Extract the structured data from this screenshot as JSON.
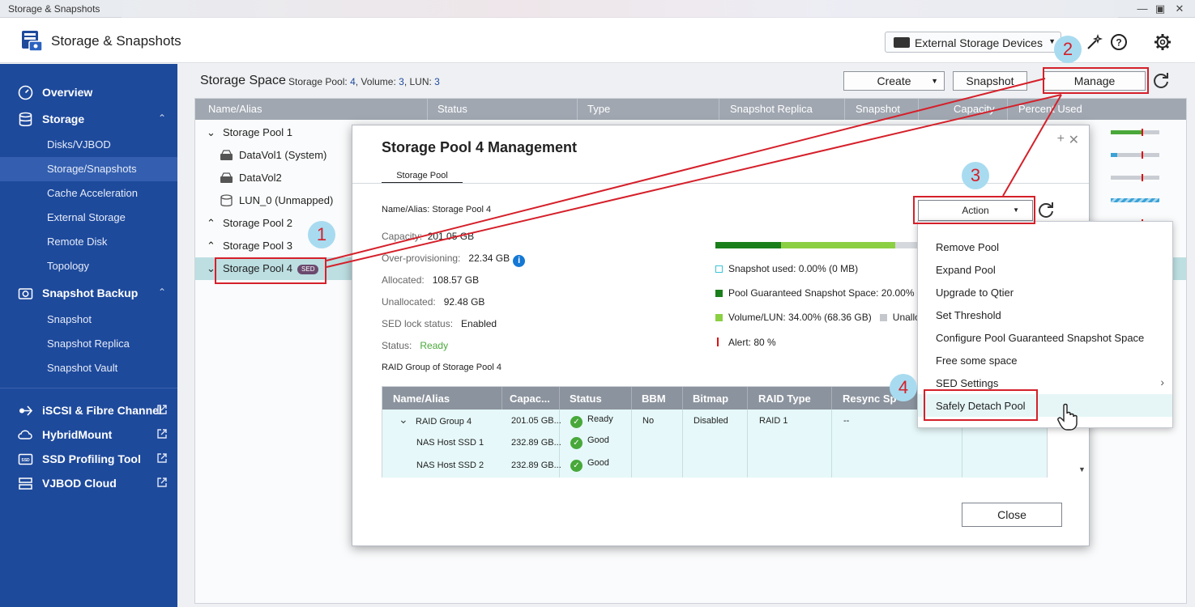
{
  "window": {
    "title": "Storage & Snapshots"
  },
  "header": {
    "app_title": "Storage & Snapshots",
    "external_devices": "External Storage Devices"
  },
  "sidebar": {
    "overview": "Overview",
    "storage": "Storage",
    "storage_items": [
      "Disks/VJBOD",
      "Storage/Snapshots",
      "Cache Acceleration",
      "External Storage",
      "Remote Disk",
      "Topology"
    ],
    "snapshot_backup": "Snapshot Backup",
    "snapshot_items": [
      "Snapshot",
      "Snapshot Replica",
      "Snapshot Vault"
    ],
    "external_links": [
      "iSCSI & Fibre Channel",
      "HybridMount",
      "SSD Profiling Tool",
      "VJBOD Cloud"
    ]
  },
  "main": {
    "title": "Storage Space",
    "subtitle": {
      "pool_label": "Storage Pool:",
      "pool_count": "4",
      "volume_label": "Volume:",
      "volume_count": "3",
      "lun_label": "LUN:",
      "lun_count": "3"
    },
    "toolbar": {
      "create": "Create",
      "snapshot": "Snapshot",
      "manage": "Manage"
    },
    "columns": [
      "Name/Alias",
      "Status",
      "Type",
      "Snapshot Replica",
      "Snapshot",
      "Capacity",
      "Percent Used"
    ],
    "rows": [
      {
        "name": "Storage Pool 1"
      },
      {
        "name": "DataVol1 (System)"
      },
      {
        "name": "DataVol2"
      },
      {
        "name": "LUN_0 (Unmapped)"
      },
      {
        "name": "Storage Pool 2"
      },
      {
        "name": "Storage Pool 3"
      },
      {
        "name": "Storage Pool 4",
        "badge": "SED"
      }
    ]
  },
  "dialog": {
    "title": "Storage Pool 4 Management",
    "tab": "Storage Pool",
    "name_alias": "Name/Alias: Storage Pool 4",
    "capacity_label": "Capacity:",
    "capacity_value": "201.05 GB",
    "overprov_label": "Over-provisioning:",
    "overprov_value": "22.34 GB",
    "allocated_label": "Allocated:",
    "allocated_value": "108.57 GB",
    "unallocated_label": "Unallocated:",
    "unallocated_value": "92.48 GB",
    "sed_label": "SED lock status:",
    "sed_value": "Enabled",
    "status_label": "Status:",
    "status_value": "Ready",
    "raid_group_title": "RAID Group of Storage Pool 4",
    "usage": {
      "guaranteed_pct": 27,
      "volume_pct": 47
    },
    "legend": {
      "snapshot_used": "Snapshot used: 0.00% (0 MB)",
      "guaranteed": "Pool Guaranteed Snapshot Space: 20.00% (",
      "volume": "Volume/LUN: 34.00% (68.36 GB)",
      "unalloc": "Unallo",
      "alert": "Alert: 80 %"
    },
    "action": "Action",
    "raid_columns": [
      "Name/Alias",
      "Capac...",
      "Status",
      "BBM",
      "Bitmap",
      "RAID Type",
      "Resync Sp"
    ],
    "raid_rows": [
      {
        "name": "RAID Group 4",
        "capacity": "201.05 GB...",
        "status": "Ready",
        "bbm": "No",
        "bitmap": "Disabled",
        "raid_type": "RAID 1",
        "resync": "--"
      },
      {
        "name": "NAS Host SSD 1",
        "capacity": "232.89 GB...",
        "status": "Good"
      },
      {
        "name": "NAS Host SSD 2",
        "capacity": "232.89 GB...",
        "status": "Good"
      }
    ],
    "close": "Close"
  },
  "action_menu": [
    "Remove Pool",
    "Expand Pool",
    "Upgrade to Qtier",
    "Set Threshold",
    "Configure Pool Guaranteed Snapshot Space",
    "Free some space",
    "SED Settings",
    "Safely Detach Pool"
  ],
  "annotations": [
    "1",
    "2",
    "3",
    "4"
  ],
  "colors": {
    "sidebar": "#1e4a9c",
    "annotation": "#d5202a",
    "step_circle": "#a8dbf0",
    "dark_green": "#1a7f1a",
    "light_green": "#8bcf43"
  }
}
